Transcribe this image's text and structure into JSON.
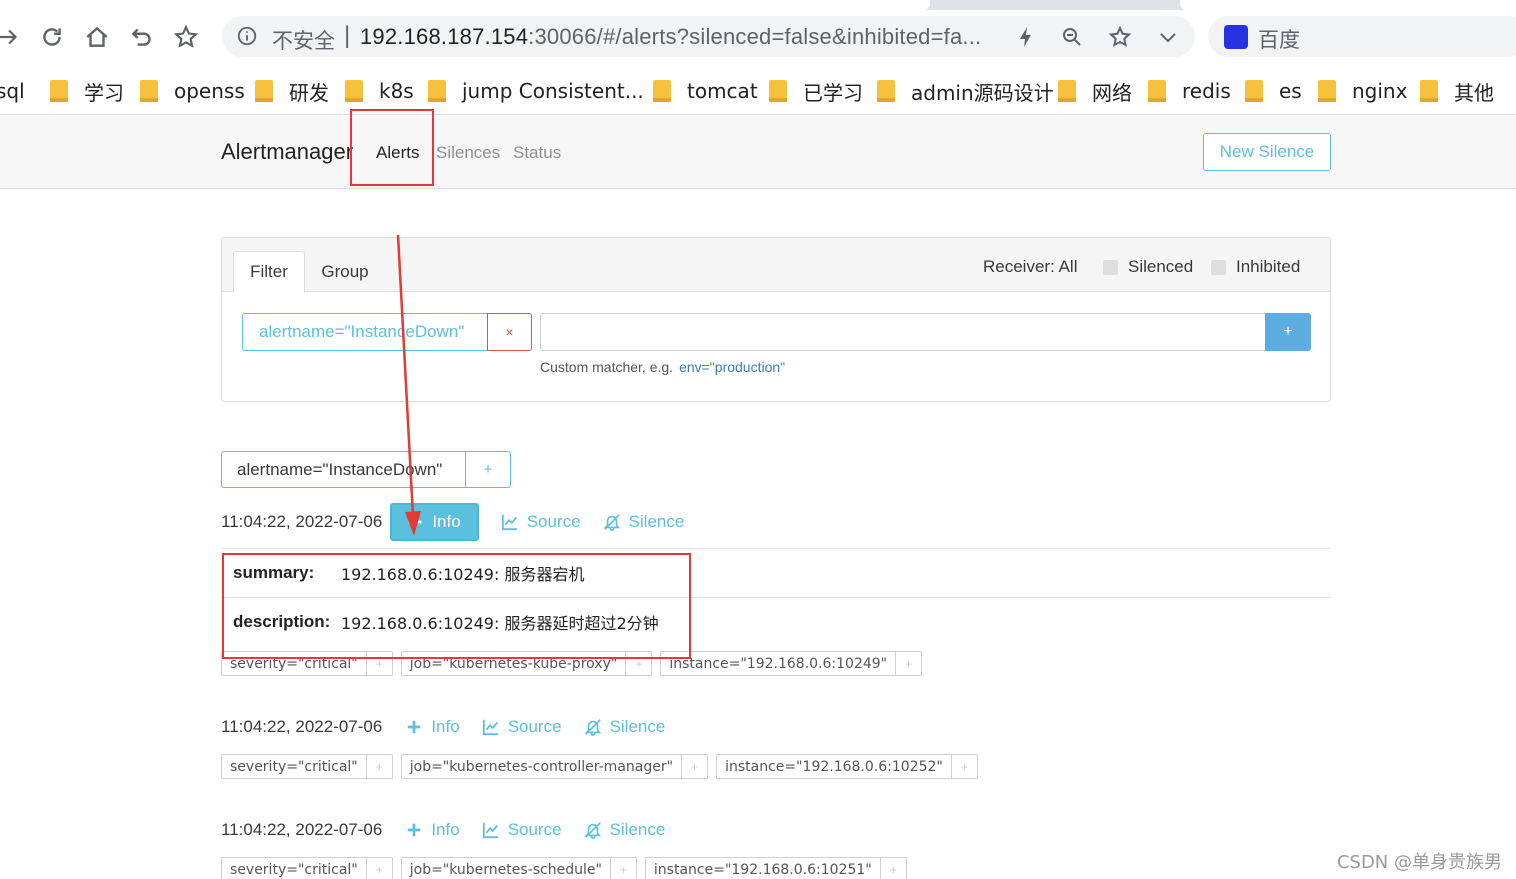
{
  "browser": {
    "insecure_label": "不安全",
    "url_host": "192.168.187.154",
    "url_rest": ":30066/#/alerts?silenced=false&inhibited=fa...",
    "search_engine_label": "百度",
    "bookmarks": [
      "sql",
      "学习",
      "openss",
      "研发",
      "k8s",
      "jump Consistent...",
      "tomcat",
      "已学习",
      "admin源码设计",
      "网络",
      "redis",
      "es",
      "nginx",
      "其他"
    ]
  },
  "navbar": {
    "brand": "Alertmanager",
    "links": [
      "Alerts",
      "Silences",
      "Status"
    ],
    "new_silence": "New Silence"
  },
  "filter": {
    "tabs": [
      "Filter",
      "Group"
    ],
    "receiver": "Receiver: All",
    "silenced": "Silenced",
    "inhibited": "Inhibited",
    "active_matcher": "alertname=\"InstanceDown\"",
    "remove_label": "×",
    "add_label": "+",
    "hint": "Custom matcher, e.g.",
    "hint_example": "env=\"production\""
  },
  "group": {
    "label": "alertname=\"InstanceDown\"",
    "add_label": "+"
  },
  "actions": {
    "info": "Info",
    "source": "Source",
    "silence": "Silence"
  },
  "alerts": [
    {
      "timestamp": "11:04:22, 2022-07-06",
      "details": [
        {
          "key": "summary:",
          "value": "192.168.0.6:10249: 服务器宕机"
        },
        {
          "key": "description:",
          "value": "192.168.0.6:10249: 服务器延时超过2分钟"
        }
      ],
      "labels": [
        "severity=\"critical\"",
        "job=\"kubernetes-kube-proxy\"",
        "instance=\"192.168.0.6:10249\""
      ]
    },
    {
      "timestamp": "11:04:22, 2022-07-06",
      "labels": [
        "severity=\"critical\"",
        "job=\"kubernetes-controller-manager\"",
        "instance=\"192.168.0.6:10252\""
      ]
    },
    {
      "timestamp": "11:04:22, 2022-07-06",
      "labels": [
        "severity=\"critical\"",
        "job=\"kubernetes-schedule\"",
        "instance=\"192.168.0.6:10251\""
      ]
    }
  ],
  "watermark": "CSDN @单身贵族男",
  "colors": {
    "accent": "#5bc0de",
    "danger": "#d9534f",
    "annotation": "#e53935"
  }
}
